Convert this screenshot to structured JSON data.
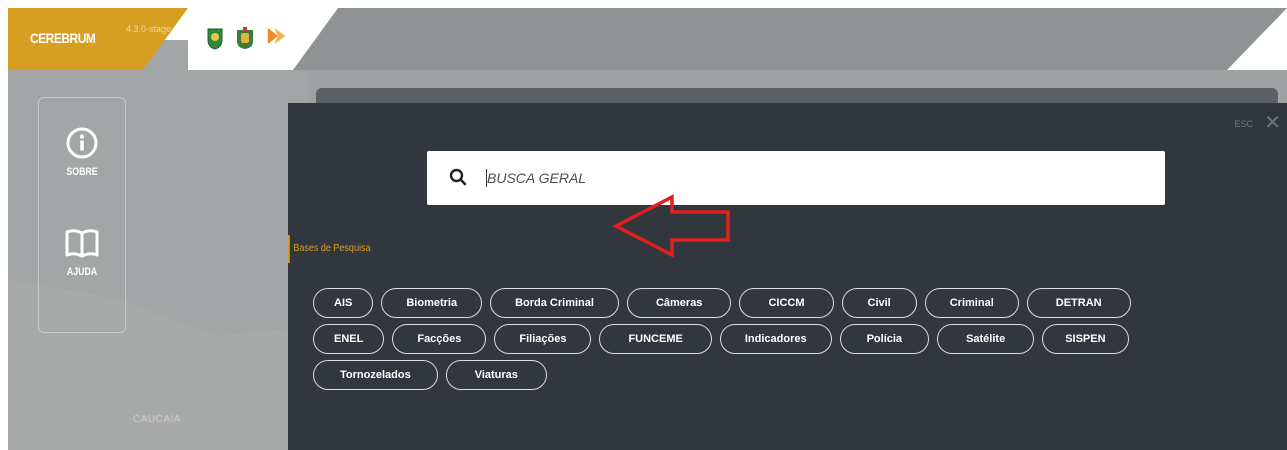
{
  "header": {
    "brand_name": "CEREBRUM",
    "version": "4.3.0-stage"
  },
  "logos": [
    "state-crest-logo",
    "police-crest-logo",
    "partner-logo"
  ],
  "sidebar": {
    "items": [
      {
        "label": "SOBRE",
        "icon": "info-icon"
      },
      {
        "label": "AJUDA",
        "icon": "book-icon"
      }
    ]
  },
  "map": {
    "place_label": "CAUCAIA"
  },
  "search": {
    "esc_label": "ESC",
    "close_label": "✕",
    "placeholder": "BUSCA GERAL",
    "value": ""
  },
  "bases": {
    "title": "Bases de Pesquisa",
    "rows": [
      [
        "AIS",
        "Biometria",
        "Borda Criminal",
        "Câmeras",
        "CICCM",
        "Civil",
        "Criminal",
        "DETRAN"
      ],
      [
        "ENEL",
        "Facções",
        "Filiações",
        "FUNCEME",
        "Indicadores",
        "Polícia",
        "Satélite",
        "SISPEN"
      ],
      [
        "Tornozelados",
        "Viaturas"
      ]
    ]
  },
  "colors": {
    "accent": "#d79f22",
    "modal_bg": "#32373d",
    "annotation_arrow": "#e0201e"
  }
}
